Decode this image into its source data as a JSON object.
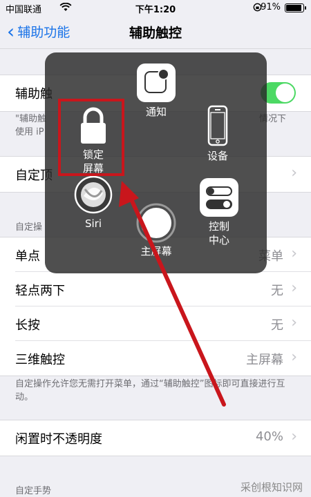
{
  "status": {
    "carrier": "中国联通",
    "time": "下午1:20",
    "battery": "91%",
    "battery_level": 0.91
  },
  "nav": {
    "back_label": "辅助功能",
    "title": "辅助触控"
  },
  "rows": {
    "assistive_touch": {
      "label": "辅助触",
      "on": true
    },
    "note_top_line1": "\"辅助触",
    "note_top_tail": "情况下",
    "note_top_line2": "使用 iP",
    "custom_top": {
      "label": "自定顶"
    },
    "section_custom_actions": "自定操",
    "single_tap": {
      "label": "单点",
      "value": "菜单"
    },
    "double_tap": {
      "label": "轻点两下",
      "value": "无"
    },
    "long_press": {
      "label": "长按",
      "value": "无"
    },
    "touch_3d": {
      "label": "三维触控",
      "value": "主屏幕"
    },
    "note_actions": "自定操作允许您无需打开菜单，通过“辅助触控”图标即可直接进行互动。",
    "idle_opacity": {
      "label": "闲置时不透明度",
      "value": "40%"
    },
    "section_custom_gestures": "自定手势"
  },
  "overlay": {
    "notification": "通知",
    "lock_screen_line1": "锁定",
    "lock_screen_line2": "屏幕",
    "device": "设备",
    "siri": "Siri",
    "control_center_line1": "控制",
    "control_center_line2": "中心",
    "home": "主屏幕"
  },
  "watermark": "采创根知识网",
  "colors": {
    "accent": "#1a73e8",
    "toggle_on": "#4cd964",
    "annotation_red": "#c9161c"
  }
}
